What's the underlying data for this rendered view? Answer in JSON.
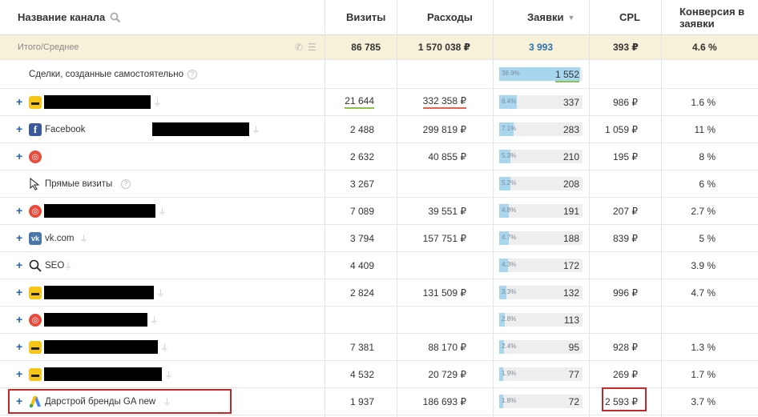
{
  "header": {
    "channel_label": "Название канала",
    "visits": "Визиты",
    "costs": "Расходы",
    "leads": "Заявки",
    "leads_sort": "▼",
    "cpl": "CPL",
    "conv_line1": "Конверсия в",
    "conv_line2": "заявки"
  },
  "total": {
    "label": "Итого/Среднее",
    "visits": "86 785",
    "costs": "1 570 038 ₽",
    "leads": "3 993",
    "cpl": "393 ₽",
    "conv": "4.6 %"
  },
  "deals": {
    "label": "Сделки, созданные самостоятельно",
    "pct": "38.9%",
    "value": "1 552",
    "fill": 0.389
  },
  "rows": [
    {
      "name": "",
      "icon": "yandex-direct-icon",
      "visits": "21 644",
      "costs": "332 358 ₽",
      "pct": "8.4%",
      "fill": 0.084,
      "leads": "337",
      "cpl": "986 ₽",
      "conv": "1.6 %"
    },
    {
      "name": "Facebook",
      "icon": "facebook-icon",
      "visits": "2 488",
      "costs": "299 819 ₽",
      "pct": "7.1%",
      "fill": 0.071,
      "leads": "283",
      "cpl": "1 059 ₽",
      "conv": "11 %"
    },
    {
      "name": "",
      "icon": "target-icon",
      "visits": "2 632",
      "costs": "40 855 ₽",
      "pct": "5.3%",
      "fill": 0.053,
      "leads": "210",
      "cpl": "195 ₽",
      "conv": "8 %"
    },
    {
      "name": "Прямые визиты",
      "icon": "cursor-icon",
      "visits": "3 267",
      "costs": "",
      "pct": "5.2%",
      "fill": 0.052,
      "leads": "208",
      "cpl": "",
      "conv": "6 %"
    },
    {
      "name": "",
      "icon": "target-icon",
      "visits": "7 089",
      "costs": "39 551 ₽",
      "pct": "4.8%",
      "fill": 0.048,
      "leads": "191",
      "cpl": "207 ₽",
      "conv": "2.7 %"
    },
    {
      "name": "vk.com",
      "icon": "vk-icon",
      "visits": "3 794",
      "costs": "157 751 ₽",
      "pct": "4.7%",
      "fill": 0.047,
      "leads": "188",
      "cpl": "839 ₽",
      "conv": "5 %"
    },
    {
      "name": "SEO",
      "icon": "search-icon",
      "visits": "4 409",
      "costs": "",
      "pct": "4.3%",
      "fill": 0.043,
      "leads": "172",
      "cpl": "",
      "conv": "3.9 %"
    },
    {
      "name": "",
      "icon": "yandex-direct-icon",
      "visits": "2 824",
      "costs": "131 509 ₽",
      "pct": "3.3%",
      "fill": 0.033,
      "leads": "132",
      "cpl": "996 ₽",
      "conv": "4.7 %"
    },
    {
      "name": "",
      "icon": "target-icon",
      "visits": "",
      "costs": "",
      "pct": "2.8%",
      "fill": 0.028,
      "leads": "113",
      "cpl": "",
      "conv": ""
    },
    {
      "name": "",
      "icon": "yandex-direct-icon",
      "visits": "7 381",
      "costs": "88 170 ₽",
      "pct": "2.4%",
      "fill": 0.024,
      "leads": "95",
      "cpl": "928 ₽",
      "conv": "1.3 %"
    },
    {
      "name": "",
      "icon": "yandex-direct-icon",
      "visits": "4 532",
      "costs": "20 729 ₽",
      "pct": "1.9%",
      "fill": 0.019,
      "leads": "77",
      "cpl": "269 ₽",
      "conv": "1.7 %"
    },
    {
      "name": "Дарстрой бренды GA new",
      "icon": "google-ads-icon",
      "visits": "1 937",
      "costs": "186 693 ₽",
      "pct": "1.8%",
      "fill": 0.018,
      "leads": "72",
      "cpl": "2 593 ₽",
      "conv": "3.7 %"
    }
  ]
}
